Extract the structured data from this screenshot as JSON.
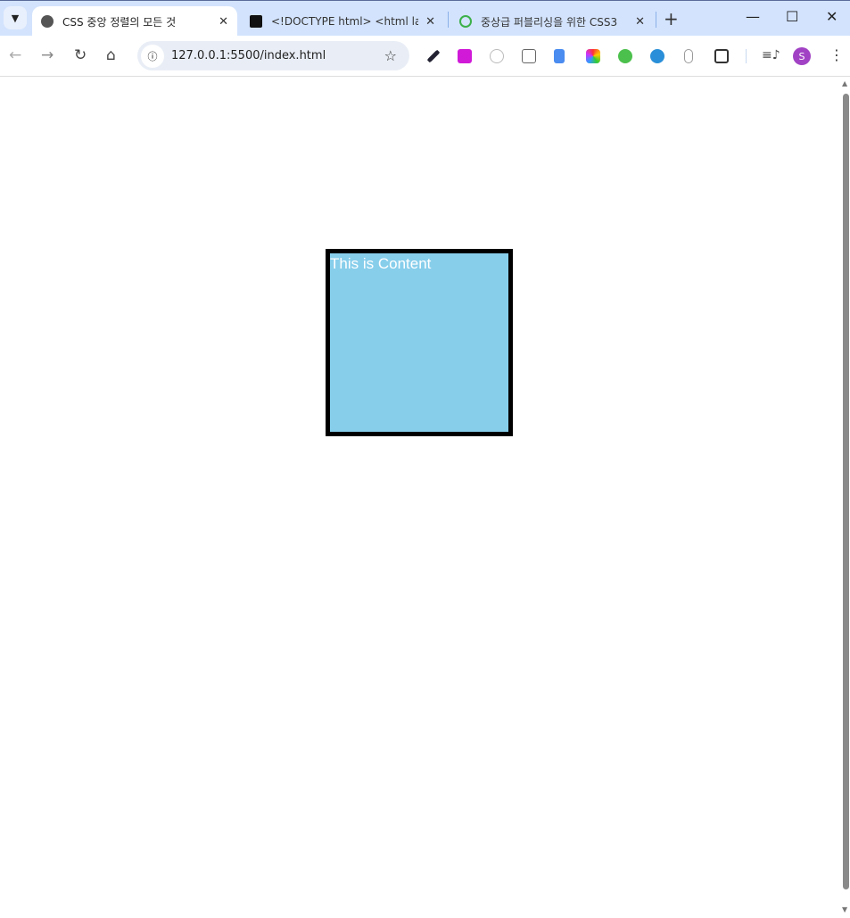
{
  "tabs": [
    {
      "title": "CSS 중앙 정렬의 모든 것",
      "active": true
    },
    {
      "title": "<!DOCTYPE html> <html lang",
      "active": false
    },
    {
      "title": "중상급 퍼블리싱을 위한 CSS3",
      "active": false
    }
  ],
  "toolbar": {
    "url": "127.0.0.1:5500/index.html",
    "avatar_letter": "S"
  },
  "extensions": [
    "color-picker-icon",
    "download-icon",
    "pencil-icon",
    "calendar-icon",
    "mobile-icon",
    "camera-icon",
    "green-circle-icon",
    "pen-icon",
    "mouse-icon",
    "puzzle-icon"
  ],
  "content": {
    "box_text": "This is Content",
    "box_color": "#87ceeb",
    "border_color": "#000000"
  }
}
